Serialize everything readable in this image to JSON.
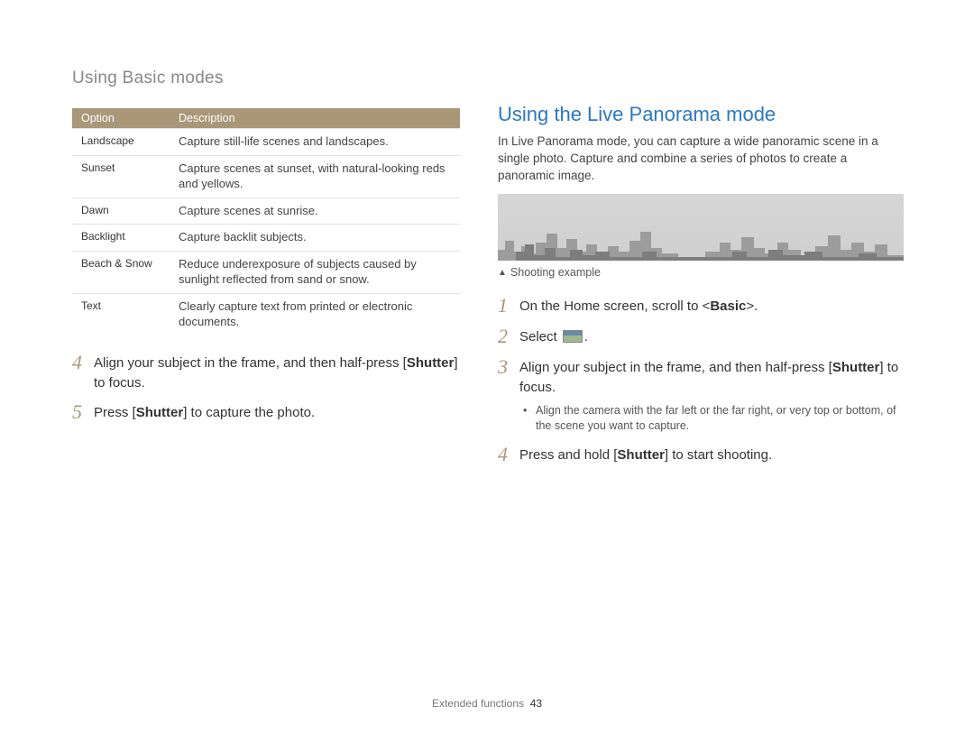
{
  "page_title": "Using Basic modes",
  "table": {
    "headers": [
      "Option",
      "Description"
    ],
    "rows": [
      {
        "option": "Landscape",
        "desc": "Capture still-life scenes and landscapes."
      },
      {
        "option": "Sunset",
        "desc": "Capture scenes at sunset, with natural-looking reds and yellows."
      },
      {
        "option": "Dawn",
        "desc": "Capture scenes at sunrise."
      },
      {
        "option": "Backlight",
        "desc": "Capture backlit subjects."
      },
      {
        "option": "Beach & Snow",
        "desc": "Reduce underexposure of subjects caused by sunlight reflected from sand or snow."
      },
      {
        "option": "Text",
        "desc": "Clearly capture text from printed or electronic documents."
      }
    ]
  },
  "left_steps": {
    "s4": {
      "num": "4",
      "pre": "Align your subject in the frame, and then half-press [",
      "bold": "Shutter",
      "post": "] to focus."
    },
    "s5": {
      "num": "5",
      "pre": "Press [",
      "bold": "Shutter",
      "post": "] to capture the photo."
    }
  },
  "right": {
    "heading": "Using the Live Panorama mode",
    "intro": "In Live Panorama mode, you can capture a wide panoramic scene in a single photo. Capture and combine a series of photos to create a panoramic image.",
    "caption": "Shooting example",
    "steps": {
      "s1": {
        "num": "1",
        "pre": "On the Home screen, scroll to <",
        "bold": "Basic",
        "post": ">."
      },
      "s2": {
        "num": "2",
        "pre": "Select ",
        "post_icon": "."
      },
      "s3": {
        "num": "3",
        "pre": "Align your subject in the frame, and then half-press [",
        "bold": "Shutter",
        "post": "] to focus."
      },
      "s3_sub": "Align the camera with the far left or the far right, or very top or bottom, of the scene you want to capture.",
      "s4": {
        "num": "4",
        "pre": "Press and hold [",
        "bold": "Shutter",
        "post": "] to start shooting."
      }
    }
  },
  "footer": {
    "section": "Extended functions",
    "page": "43"
  }
}
